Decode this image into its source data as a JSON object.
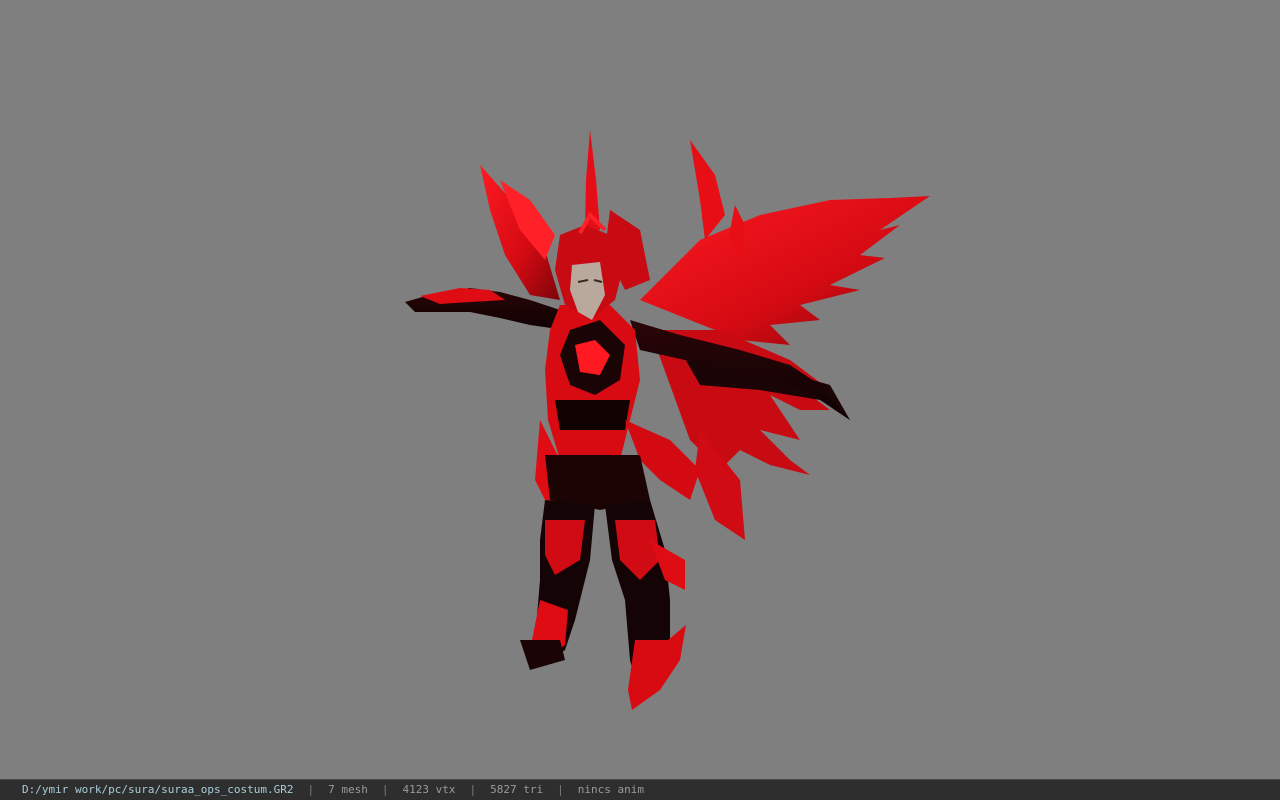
{
  "viewer": {
    "background_color": "#7f7f7f",
    "model": {
      "icon": "character-model",
      "primary_color": "#e00c14",
      "dark_color": "#150405",
      "skin_color": "#b9a99d"
    }
  },
  "status_bar": {
    "file_path": "D:/ymir work/pc/sura/suraa_ops_costum.GR2",
    "separator": "|",
    "mesh_count": "7 mesh",
    "vertex_count": "4123 vtx",
    "triangle_count": "5827 tri",
    "animation": "nincs anim"
  }
}
